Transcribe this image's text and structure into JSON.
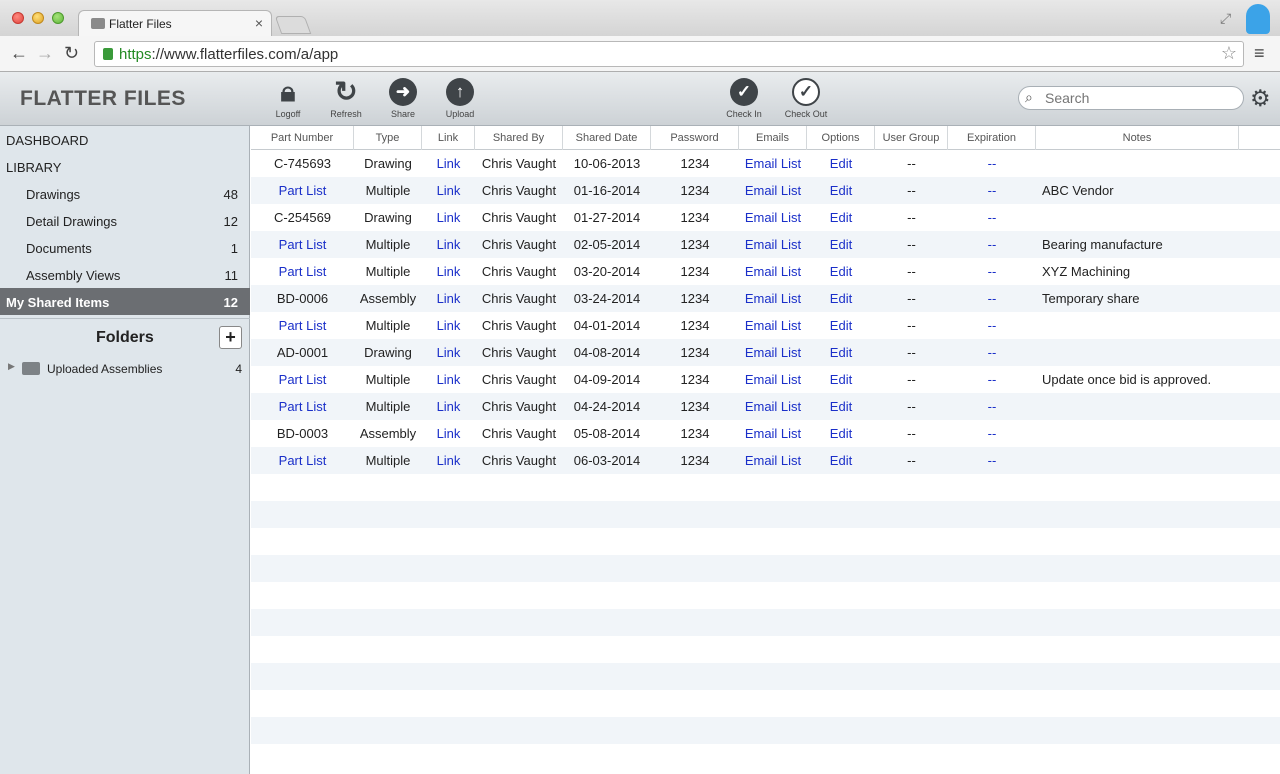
{
  "browser": {
    "tab_title": "Flatter Files",
    "url_scheme": "https",
    "url_rest": "://www.flatterfiles.com/a/app"
  },
  "header": {
    "brand": "FLATTER FILES",
    "tools": [
      {
        "label": "Logoff",
        "icon": "lock-icon"
      },
      {
        "label": "Refresh",
        "icon": "refresh-icon"
      },
      {
        "label": "Share",
        "icon": "arrow-right-icon"
      },
      {
        "label": "Upload",
        "icon": "arrow-up-icon"
      },
      {
        "label": "Check In",
        "icon": "check-icon"
      },
      {
        "label": "Check Out",
        "icon": "check-outline-icon"
      }
    ],
    "search_placeholder": "Search"
  },
  "sidebar": {
    "dashboard": "DASHBOARD",
    "library": "LIBRARY",
    "items": [
      {
        "label": "Drawings",
        "count": "48"
      },
      {
        "label": "Detail Drawings",
        "count": "12"
      },
      {
        "label": "Documents",
        "count": "1"
      },
      {
        "label": "Assembly Views",
        "count": "11"
      }
    ],
    "shared": {
      "label": "My Shared Items",
      "count": "12"
    },
    "folders_title": "Folders",
    "folders_add": "+",
    "folder": {
      "label": "Uploaded Assemblies",
      "count": "4"
    }
  },
  "table": {
    "headers": [
      "Part Number",
      "Type",
      "Link",
      "Shared By",
      "Shared Date",
      "Password",
      "Emails",
      "Options",
      "User Group",
      "Expiration",
      "Notes"
    ],
    "rows": [
      {
        "part": "C-745693",
        "part_link": false,
        "type": "Drawing",
        "link": "Link",
        "by": "Chris Vaught",
        "date": "10-06-2013",
        "pw": "1234",
        "emails": "Email List",
        "options": "Edit",
        "group": "--",
        "exp": "--",
        "notes": ""
      },
      {
        "part": "Part List",
        "part_link": true,
        "type": "Multiple",
        "link": "Link",
        "by": "Chris Vaught",
        "date": "01-16-2014",
        "pw": "1234",
        "emails": "Email List",
        "options": "Edit",
        "group": "--",
        "exp": "--",
        "notes": "ABC Vendor"
      },
      {
        "part": "C-254569",
        "part_link": false,
        "type": "Drawing",
        "link": "Link",
        "by": "Chris Vaught",
        "date": "01-27-2014",
        "pw": "1234",
        "emails": "Email List",
        "options": "Edit",
        "group": "--",
        "exp": "--",
        "notes": ""
      },
      {
        "part": "Part List",
        "part_link": true,
        "type": "Multiple",
        "link": "Link",
        "by": "Chris Vaught",
        "date": "02-05-2014",
        "pw": "1234",
        "emails": "Email List",
        "options": "Edit",
        "group": "--",
        "exp": "--",
        "notes": "Bearing manufacture"
      },
      {
        "part": "Part List",
        "part_link": true,
        "type": "Multiple",
        "link": "Link",
        "by": "Chris Vaught",
        "date": "03-20-2014",
        "pw": "1234",
        "emails": "Email List",
        "options": "Edit",
        "group": "--",
        "exp": "--",
        "notes": "XYZ Machining"
      },
      {
        "part": "BD-0006",
        "part_link": false,
        "type": "Assembly",
        "link": "Link",
        "by": "Chris Vaught",
        "date": "03-24-2014",
        "pw": "1234",
        "emails": "Email List",
        "options": "Edit",
        "group": "--",
        "exp": "--",
        "notes": "Temporary share"
      },
      {
        "part": "Part List",
        "part_link": true,
        "type": "Multiple",
        "link": "Link",
        "by": "Chris Vaught",
        "date": "04-01-2014",
        "pw": "1234",
        "emails": "Email List",
        "options": "Edit",
        "group": "--",
        "exp": "--",
        "notes": ""
      },
      {
        "part": "AD-0001",
        "part_link": false,
        "type": "Drawing",
        "link": "Link",
        "by": "Chris Vaught",
        "date": "04-08-2014",
        "pw": "1234",
        "emails": "Email List",
        "options": "Edit",
        "group": "--",
        "exp": "--",
        "notes": ""
      },
      {
        "part": "Part List",
        "part_link": true,
        "type": "Multiple",
        "link": "Link",
        "by": "Chris Vaught",
        "date": "04-09-2014",
        "pw": "1234",
        "emails": "Email List",
        "options": "Edit",
        "group": "--",
        "exp": "--",
        "notes": "Update once bid is approved."
      },
      {
        "part": "Part List",
        "part_link": true,
        "type": "Multiple",
        "link": "Link",
        "by": "Chris Vaught",
        "date": "04-24-2014",
        "pw": "1234",
        "emails": "Email List",
        "options": "Edit",
        "group": "--",
        "exp": "--",
        "notes": ""
      },
      {
        "part": "BD-0003",
        "part_link": false,
        "type": "Assembly",
        "link": "Link",
        "by": "Chris Vaught",
        "date": "05-08-2014",
        "pw": "1234",
        "emails": "Email List",
        "options": "Edit",
        "group": "--",
        "exp": "--",
        "notes": ""
      },
      {
        "part": "Part List",
        "part_link": true,
        "type": "Multiple",
        "link": "Link",
        "by": "Chris Vaught",
        "date": "06-03-2014",
        "pw": "1234",
        "emails": "Email List",
        "options": "Edit",
        "group": "--",
        "exp": "--",
        "notes": ""
      }
    ]
  },
  "colors": {
    "link": "#1a2fc9",
    "selected_bg": "#6b6e72",
    "sidebar_bg": "#dfe6eb",
    "row_alt": "#f1f5f9"
  }
}
